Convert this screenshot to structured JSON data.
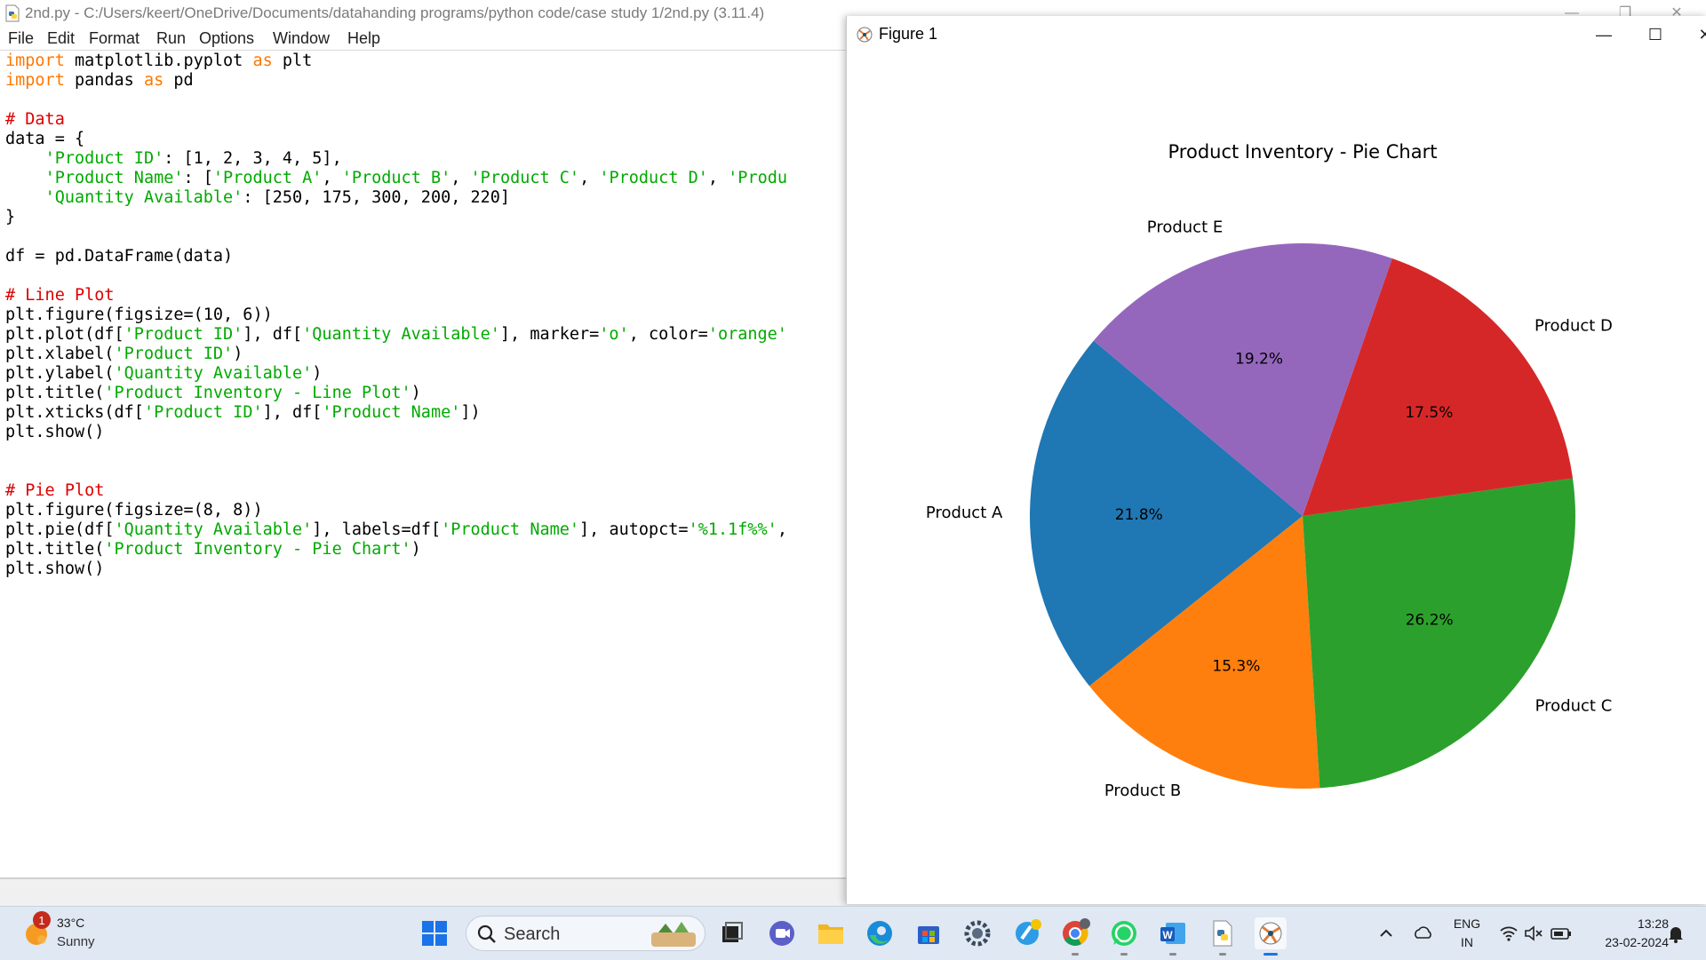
{
  "idle": {
    "title": "2nd.py - C:/Users/keert/OneDrive/Documents/datahanding programs/python code/case study 1/2nd.py (3.11.4)",
    "menu": [
      "File",
      "Edit",
      "Format",
      "Run",
      "Options",
      "Window",
      "Help"
    ],
    "code_lines": [
      [
        [
          "kw",
          "import"
        ],
        [
          "t",
          " matplotlib.pyplot "
        ],
        [
          "kw",
          "as"
        ],
        [
          "t",
          " plt"
        ]
      ],
      [
        [
          "kw",
          "import"
        ],
        [
          "t",
          " pandas "
        ],
        [
          "kw",
          "as"
        ],
        [
          "t",
          " pd"
        ]
      ],
      [],
      [
        [
          "cm",
          "# Data"
        ]
      ],
      [
        [
          "t",
          "data = {"
        ]
      ],
      [
        [
          "t",
          "    "
        ],
        [
          "str",
          "'Product ID'"
        ],
        [
          "t",
          ": [1, 2, 3, 4, 5],"
        ]
      ],
      [
        [
          "t",
          "    "
        ],
        [
          "str",
          "'Product Name'"
        ],
        [
          "t",
          ": ["
        ],
        [
          "str",
          "'Product A'"
        ],
        [
          "t",
          ", "
        ],
        [
          "str",
          "'Product B'"
        ],
        [
          "t",
          ", "
        ],
        [
          "str",
          "'Product C'"
        ],
        [
          "t",
          ", "
        ],
        [
          "str",
          "'Product D'"
        ],
        [
          "t",
          ", "
        ],
        [
          "str",
          "'Produ"
        ]
      ],
      [
        [
          "t",
          "    "
        ],
        [
          "str",
          "'Quantity Available'"
        ],
        [
          "t",
          ": [250, 175, 300, 200, 220]"
        ]
      ],
      [
        [
          "t",
          "}"
        ]
      ],
      [],
      [
        [
          "t",
          "df = pd.DataFrame(data)"
        ]
      ],
      [],
      [
        [
          "cm",
          "# Line Plot"
        ]
      ],
      [
        [
          "t",
          "plt.figure(figsize=(10, 6))"
        ]
      ],
      [
        [
          "t",
          "plt.plot(df["
        ],
        [
          "str",
          "'Product ID'"
        ],
        [
          "t",
          "], df["
        ],
        [
          "str",
          "'Quantity Available'"
        ],
        [
          "t",
          "], marker="
        ],
        [
          "str",
          "'o'"
        ],
        [
          "t",
          ", color="
        ],
        [
          "str",
          "'orange'"
        ]
      ],
      [
        [
          "t",
          "plt.xlabel("
        ],
        [
          "str",
          "'Product ID'"
        ],
        [
          "t",
          ")"
        ]
      ],
      [
        [
          "t",
          "plt.ylabel("
        ],
        [
          "str",
          "'Quantity Available'"
        ],
        [
          "t",
          ")"
        ]
      ],
      [
        [
          "t",
          "plt.title("
        ],
        [
          "str",
          "'Product Inventory - Line Plot'"
        ],
        [
          "t",
          ")"
        ]
      ],
      [
        [
          "t",
          "plt.xticks(df["
        ],
        [
          "str",
          "'Product ID'"
        ],
        [
          "t",
          "], df["
        ],
        [
          "str",
          "'Product Name'"
        ],
        [
          "t",
          "])"
        ]
      ],
      [
        [
          "t",
          "plt.show()"
        ]
      ],
      [],
      [],
      [
        [
          "cm",
          "# Pie Plot"
        ]
      ],
      [
        [
          "t",
          "plt.figure(figsize=(8, 8))"
        ]
      ],
      [
        [
          "t",
          "plt.pie(df["
        ],
        [
          "str",
          "'Quantity Available'"
        ],
        [
          "t",
          "], labels=df["
        ],
        [
          "str",
          "'Product Name'"
        ],
        [
          "t",
          "], autopct="
        ],
        [
          "str",
          "'%1.1f%%'"
        ],
        [
          "t",
          ","
        ]
      ],
      [
        [
          "t",
          "plt.title("
        ],
        [
          "str",
          "'Product Inventory - Pie Chart'"
        ],
        [
          "t",
          ")"
        ]
      ],
      [
        [
          "t",
          "plt.show()"
        ]
      ]
    ]
  },
  "figure": {
    "window_title": "Figure 1"
  },
  "chart_data": {
    "type": "pie",
    "title": "Product Inventory - Pie Chart",
    "labels": [
      "Product A",
      "Product B",
      "Product C",
      "Product D",
      "Product E"
    ],
    "values": [
      250,
      175,
      300,
      200,
      220
    ],
    "autopct": [
      "21.8%",
      "15.3%",
      "26.2%",
      "17.5%",
      "19.2%"
    ],
    "colors": [
      "#1f77b4",
      "#ff7f0e",
      "#2ca02c",
      "#d62728",
      "#9467bd"
    ],
    "startangle": 140
  },
  "taskbar": {
    "weather_temp": "33°C",
    "weather_desc": "Sunny",
    "weather_badge": "1",
    "search_label": "Search",
    "language": "ENG",
    "region": "IN",
    "time": "13:28",
    "date": "23-02-2024"
  }
}
